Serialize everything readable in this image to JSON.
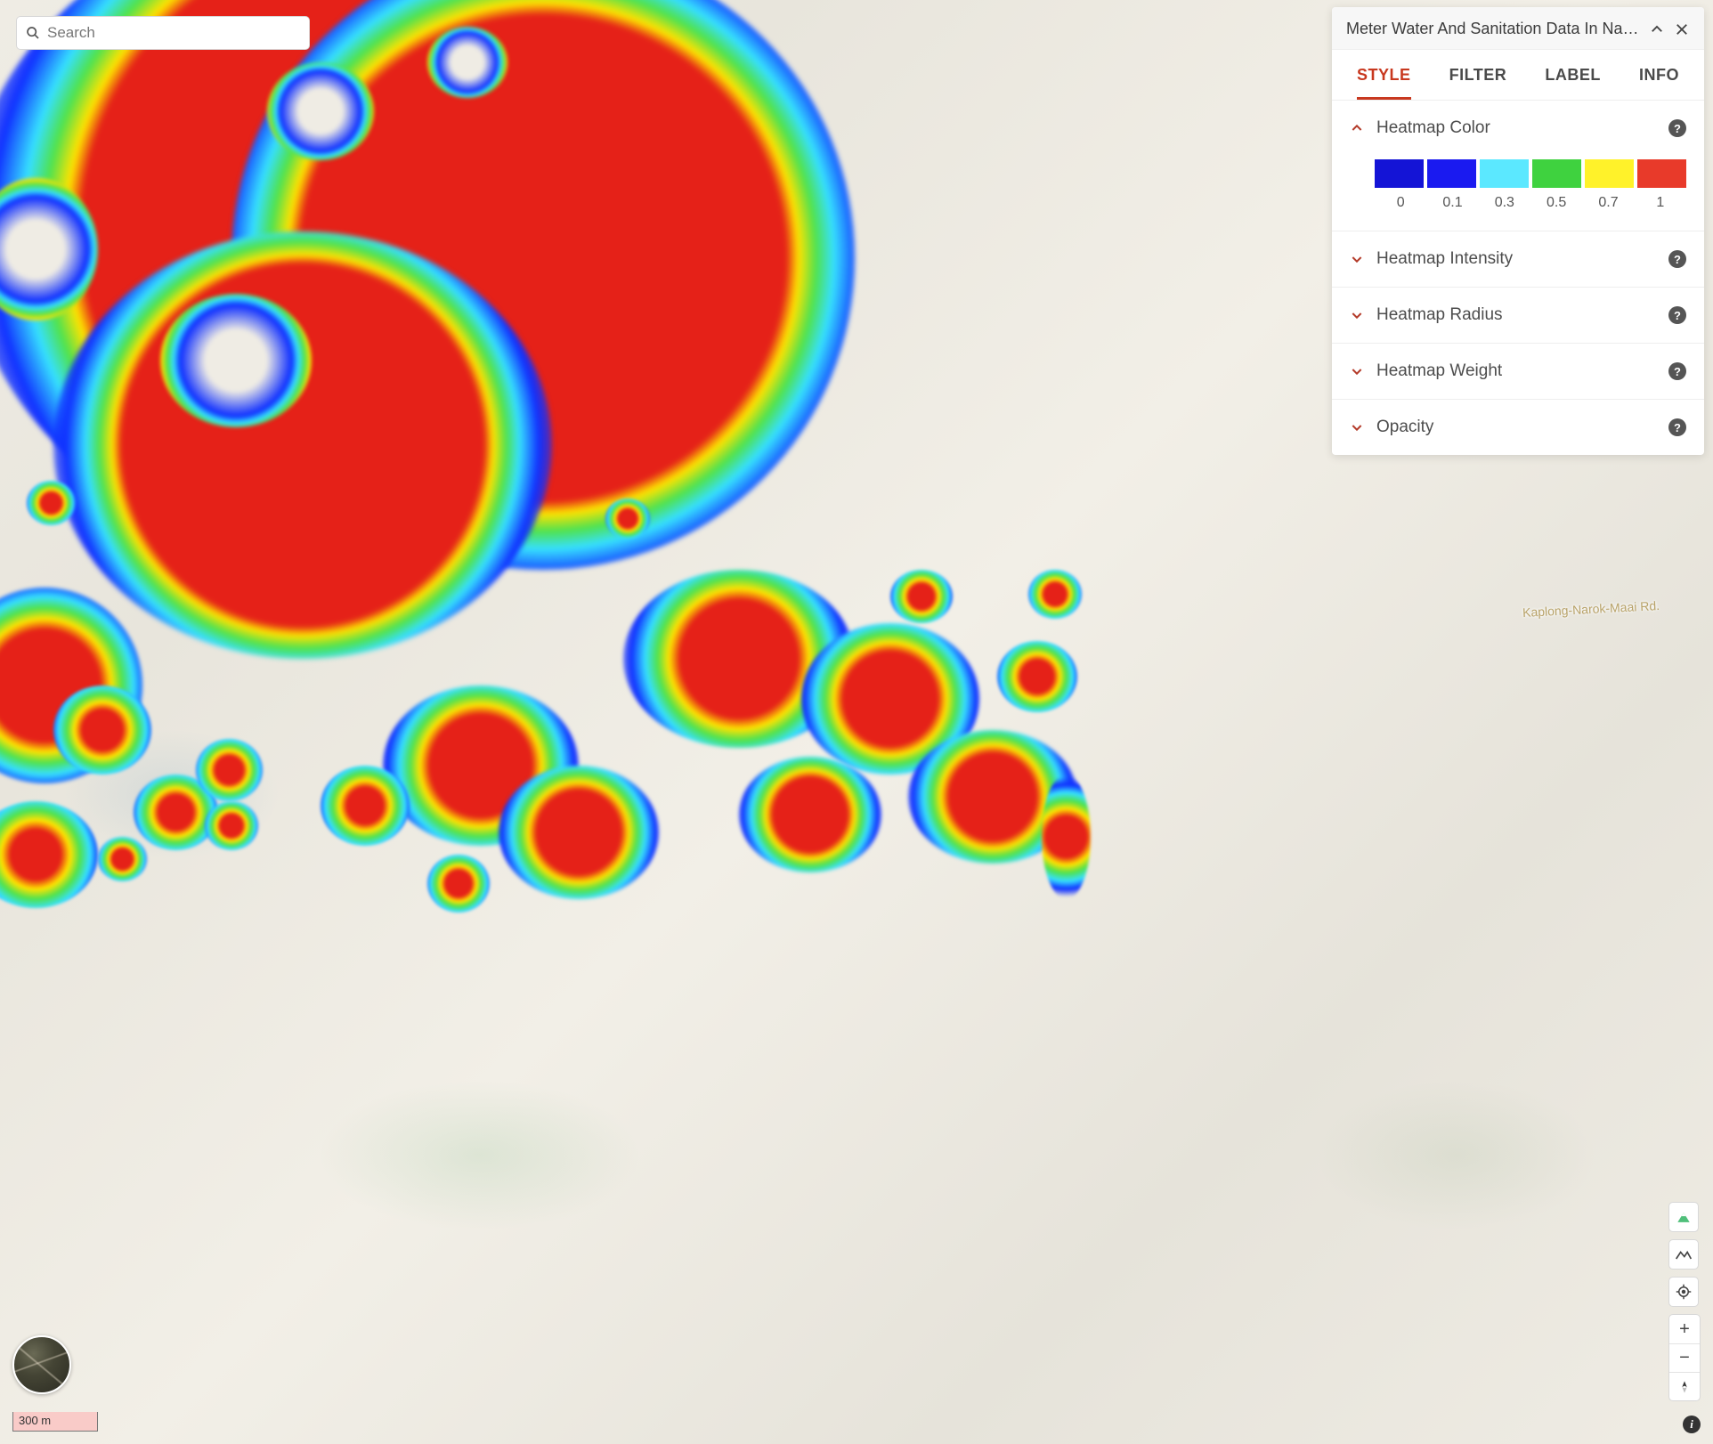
{
  "search": {
    "placeholder": "Search"
  },
  "panel": {
    "title": "Meter Water And Sanitation Data In Na…",
    "tabs": [
      {
        "id": "style",
        "label": "STYLE",
        "active": true
      },
      {
        "id": "filter",
        "label": "FILTER",
        "active": false
      },
      {
        "id": "label",
        "label": "LABEL",
        "active": false
      },
      {
        "id": "info",
        "label": "INFO",
        "active": false
      }
    ],
    "sections": {
      "heatmap_color": {
        "label": "Heatmap Color",
        "expanded": true
      },
      "heatmap_intensity": {
        "label": "Heatmap Intensity",
        "expanded": false
      },
      "heatmap_radius": {
        "label": "Heatmap Radius",
        "expanded": false
      },
      "heatmap_weight": {
        "label": "Heatmap Weight",
        "expanded": false
      },
      "opacity": {
        "label": "Opacity",
        "expanded": false
      }
    },
    "color_ramp": {
      "stops": [
        {
          "value": "0",
          "color": "#1414d6"
        },
        {
          "value": "0.1",
          "color": "#1a1af0"
        },
        {
          "value": "0.3",
          "color": "#5be8ff"
        },
        {
          "value": "0.5",
          "color": "#3fd23f"
        },
        {
          "value": "0.7",
          "color": "#fff22a"
        },
        {
          "value": "1",
          "color": "#e83a2a"
        }
      ]
    }
  },
  "map": {
    "scale_label": "300 m",
    "road_label": "Kaplong-Narok-Maai Rd."
  },
  "controls": {
    "zoom_in": "+",
    "zoom_out": "−"
  },
  "chart_data": {
    "type": "heatmap",
    "title": "Meter Water And Sanitation Data In Narok",
    "color_scale": [
      {
        "value": 0.0,
        "color": "#1414d6"
      },
      {
        "value": 0.1,
        "color": "#1a1af0"
      },
      {
        "value": 0.3,
        "color": "#5be8ff"
      },
      {
        "value": 0.5,
        "color": "#3fd23f"
      },
      {
        "value": 0.7,
        "color": "#fff22a"
      },
      {
        "value": 1.0,
        "color": "#e83a2a"
      }
    ],
    "scale_bar_m": 300,
    "notes": "Geospatial density heatmap rendered over a street basemap; dominant central cluster at intensity ≈1 with scattered peripheral clusters."
  }
}
